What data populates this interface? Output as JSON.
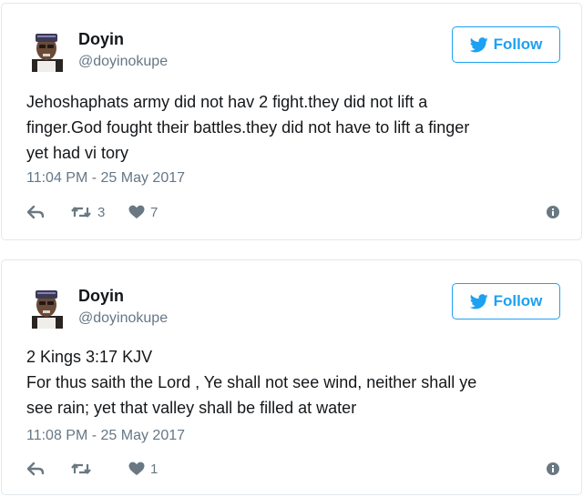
{
  "colors": {
    "accent": "#1da1f2",
    "muted": "#657786",
    "icon": "#697882",
    "border": "#e1e8ed"
  },
  "tweets": [
    {
      "author": {
        "name": "Doyin",
        "handle": "@doyinokupe"
      },
      "follow_label": "Follow",
      "lines": [
        "Jehoshaphats army did not hav 2 fight.they did not lift a",
        "finger.God fought their battles.they did not have to lift a finger",
        "yet had vi tory"
      ],
      "timestamp": "11:04 PM - 25 May 2017",
      "retweets": "3",
      "likes": "7",
      "icons": {
        "reply": "reply-icon",
        "retweet": "retweet-icon",
        "like": "heart-icon",
        "info": "info-icon"
      }
    },
    {
      "author": {
        "name": "Doyin",
        "handle": "@doyinokupe"
      },
      "follow_label": "Follow",
      "lines": [
        "2 Kings 3:17 KJV",
        "For thus saith the Lord , Ye shall not see wind, neither shall ye",
        "see rain; yet that valley shall be filled at water"
      ],
      "timestamp": "11:08 PM - 25 May 2017",
      "retweets": "",
      "likes": "1",
      "icons": {
        "reply": "reply-icon",
        "retweet": "retweet-icon",
        "like": "heart-icon",
        "info": "info-icon"
      }
    }
  ]
}
